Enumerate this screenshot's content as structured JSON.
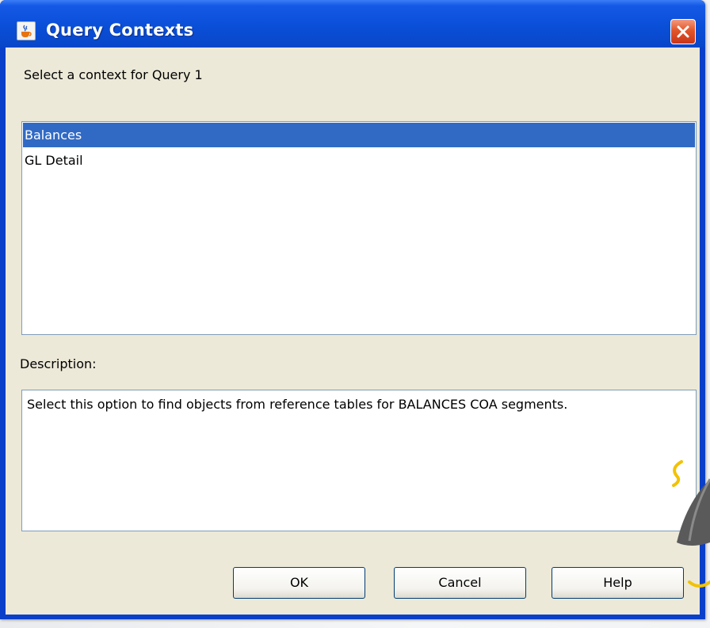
{
  "window": {
    "title": "Query Contexts",
    "title_icon": "java-cup-icon",
    "close_icon": "close-icon"
  },
  "prompt": "Select a context for Query 1",
  "contexts": {
    "items": [
      {
        "label": "Balances",
        "selected": true
      },
      {
        "label": "GL Detail",
        "selected": false
      }
    ]
  },
  "description": {
    "label": "Description:",
    "text": "Select this option to find objects from reference tables for BALANCES COA segments."
  },
  "buttons": {
    "ok": "OK",
    "cancel": "Cancel",
    "help": "Help"
  },
  "colors": {
    "titlebar": "#0a4fd8",
    "selection": "#316ac5",
    "dialog_bg": "#ece9d8",
    "close_button": "#e2552a"
  }
}
